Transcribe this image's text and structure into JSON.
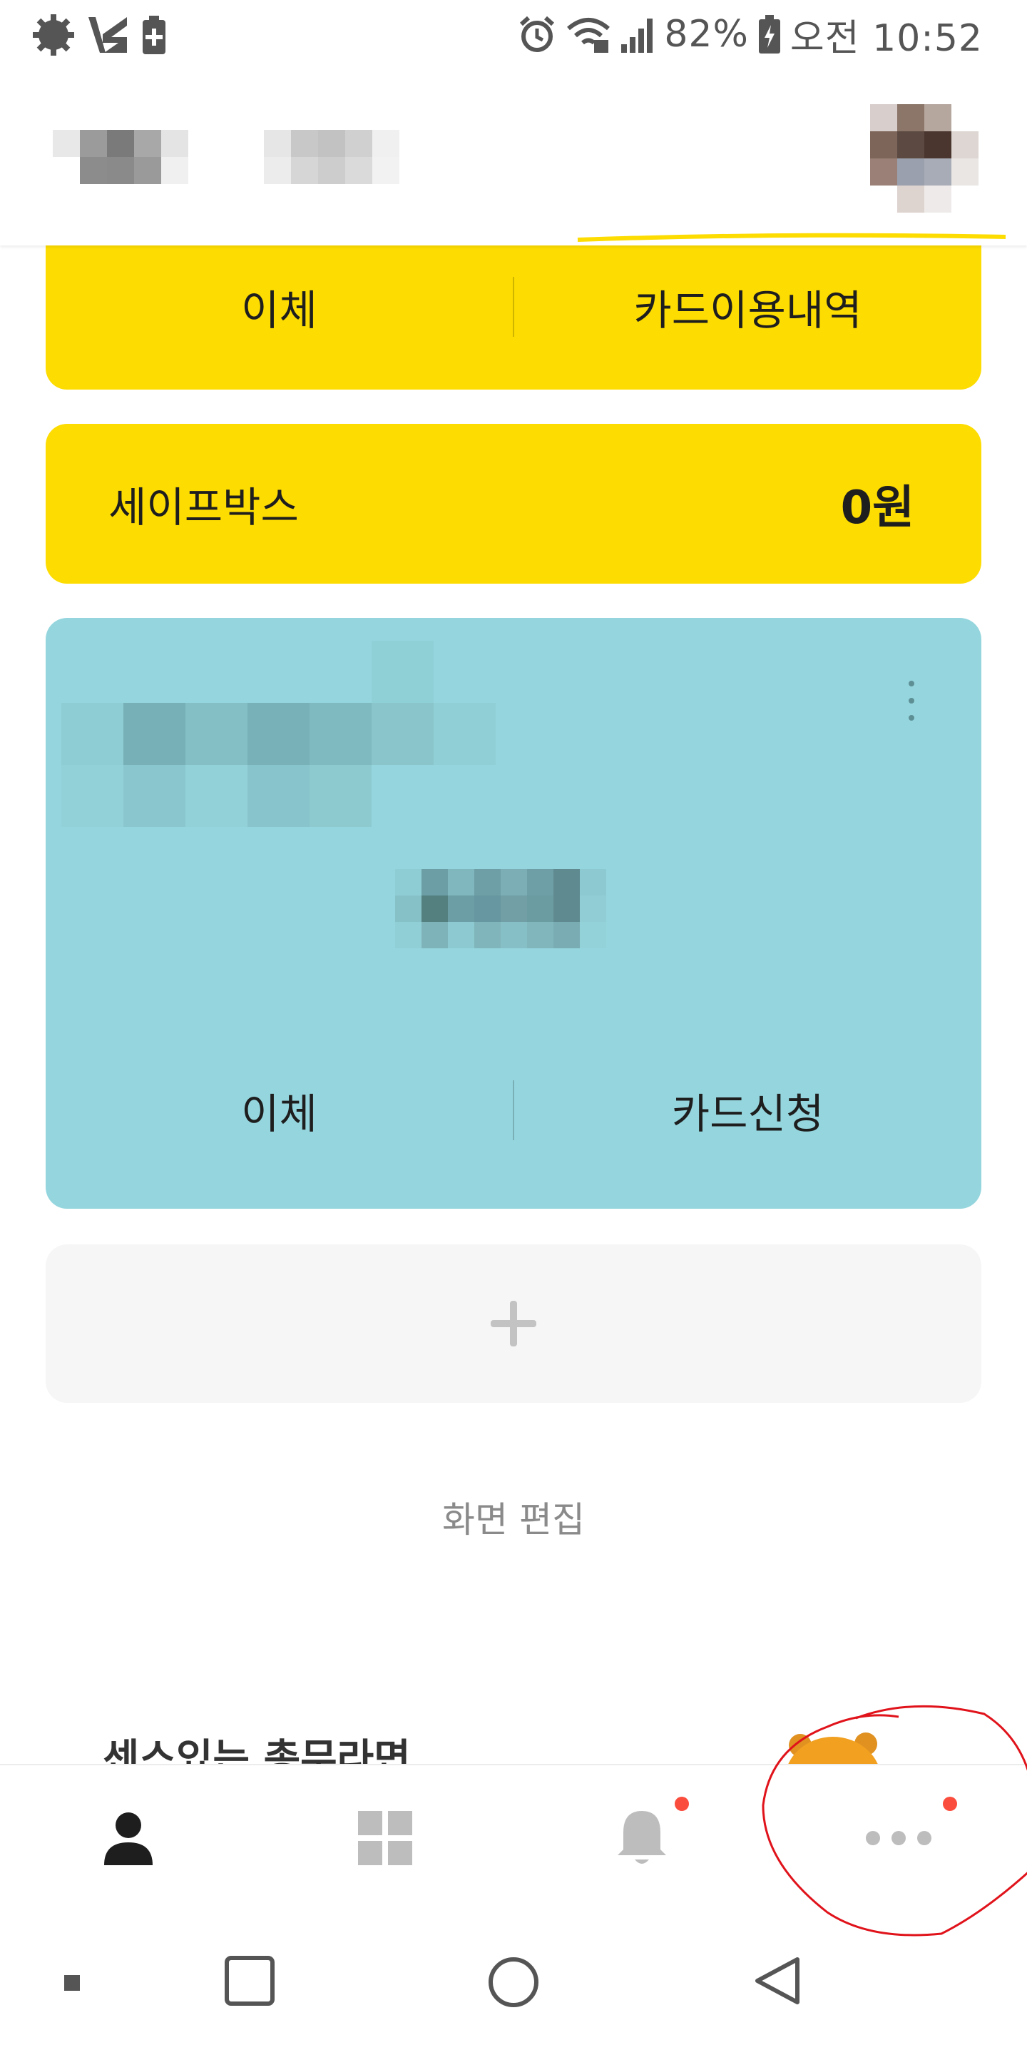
{
  "status_bar": {
    "battery": "82%",
    "time": "오전 10:52",
    "icons": [
      "gear-notification-icon",
      "vpn-icon",
      "battery-saver-icon",
      "alarm-icon",
      "wifi-icon",
      "signal-icon",
      "battery-icon"
    ]
  },
  "header": {
    "title_redacted": true,
    "avatar_redacted": true
  },
  "main_account_card": {
    "transfer_label": "이체",
    "card_usage_label": "카드이용내역"
  },
  "safebox": {
    "label": "세이프박스",
    "amount": "0원"
  },
  "secondary_account_card": {
    "name_redacted": true,
    "balance_redacted": true,
    "transfer_label": "이체",
    "card_apply_label": "카드신청"
  },
  "add_card": {
    "icon": "plus-icon"
  },
  "edit_screen_label": "화면 편집",
  "promo": {
    "text": "센스있는 총무라면"
  },
  "bottom_tabs": [
    {
      "name": "my-account",
      "icon": "person-icon",
      "active": true,
      "badge": false
    },
    {
      "name": "all-menu",
      "icon": "grid-icon",
      "active": false,
      "badge": false
    },
    {
      "name": "notifications",
      "icon": "bell-icon",
      "active": false,
      "badge": true
    },
    {
      "name": "more",
      "icon": "more-dots-icon",
      "active": false,
      "badge": true
    }
  ],
  "colors": {
    "brand_yellow": "#fddc01",
    "teal_card": "#95d6de",
    "badge_red": "#fb4d3d",
    "annotation_red": "#e0131b"
  },
  "android_nav": [
    "recents-icon",
    "home-icon",
    "back-icon"
  ]
}
